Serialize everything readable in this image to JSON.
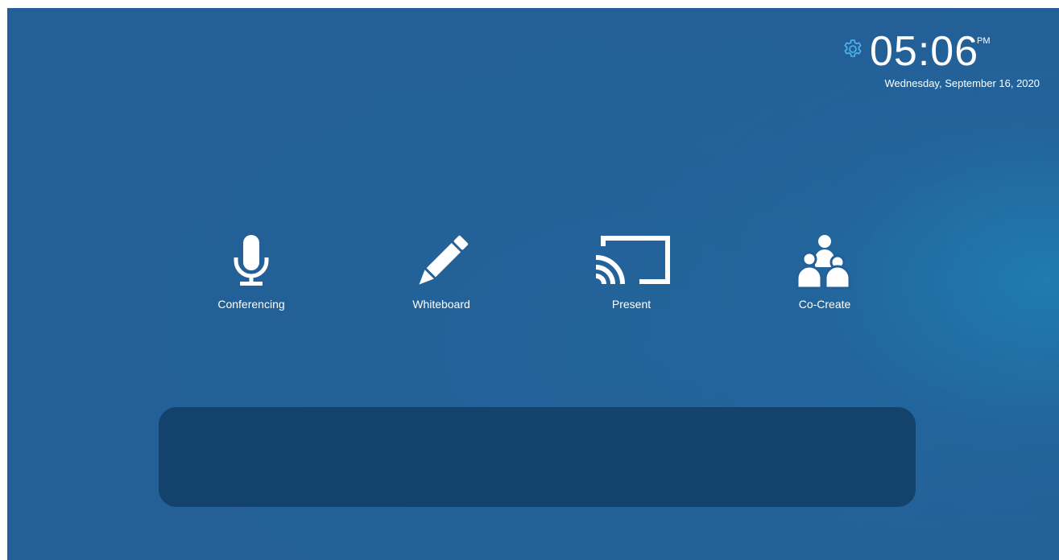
{
  "clock": {
    "time": "05:06",
    "ampm": "PM",
    "date": "Wednesday, September 16, 2020"
  },
  "settings": {
    "icon": "gear-icon"
  },
  "apps": [
    {
      "label": "Conferencing",
      "icon": "microphone-icon"
    },
    {
      "label": "Whiteboard",
      "icon": "pencil-icon"
    },
    {
      "label": "Present",
      "icon": "cast-icon"
    },
    {
      "label": "Co-Create",
      "icon": "people-group-icon"
    }
  ],
  "colors": {
    "background": "#245f97",
    "accent": "#1f80b2",
    "panel": "#13436d",
    "gear": "#4fb6ee",
    "text": "#ffffff"
  }
}
